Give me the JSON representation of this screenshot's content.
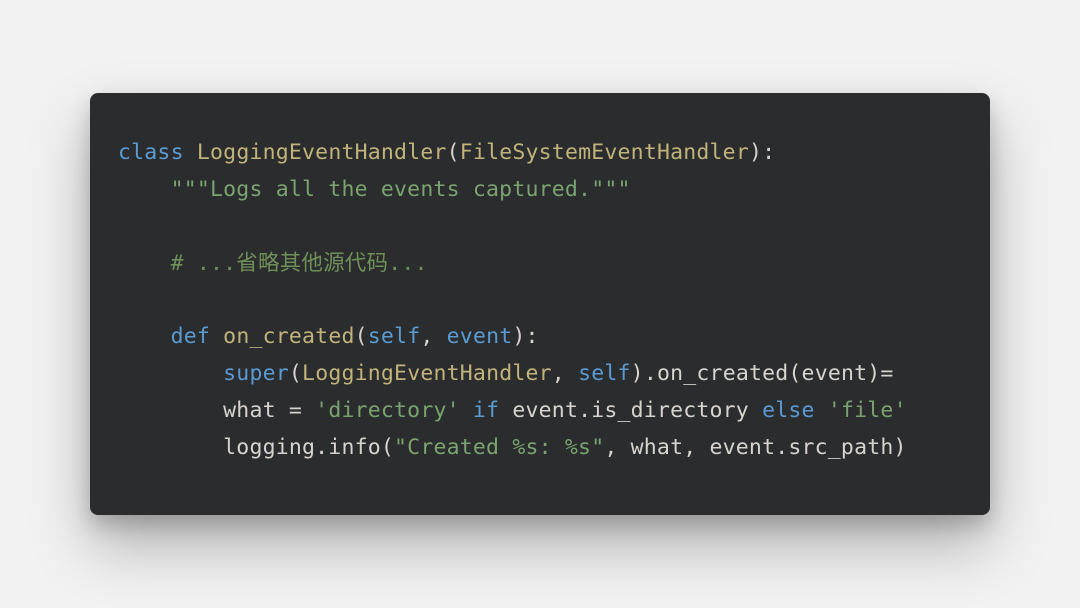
{
  "code": {
    "language": "python",
    "tokens": {
      "kw_class": "class",
      "class_name": "LoggingEventHandler",
      "base_class": "FileSystemEventHandler",
      "docstring": "\"\"\"Logs all the events captured.\"\"\"",
      "comment_omit": "# ...省略其他源代码...",
      "kw_def": "def",
      "method_name": "on_created",
      "param_self": "self",
      "param_event": "event",
      "kw_super": "super",
      "call_on_created": ".on_created(event)=",
      "var_what": "what = ",
      "str_directory": "'directory'",
      "kw_if": "if",
      "attr_is_directory": " event.is_directory ",
      "kw_else": "else",
      "str_file": "'file'",
      "logging_call_pre": "logging.info(",
      "str_created_fmt": "\"Created %s: %s\"",
      "logging_call_post": ", what, event.src_path)"
    }
  }
}
